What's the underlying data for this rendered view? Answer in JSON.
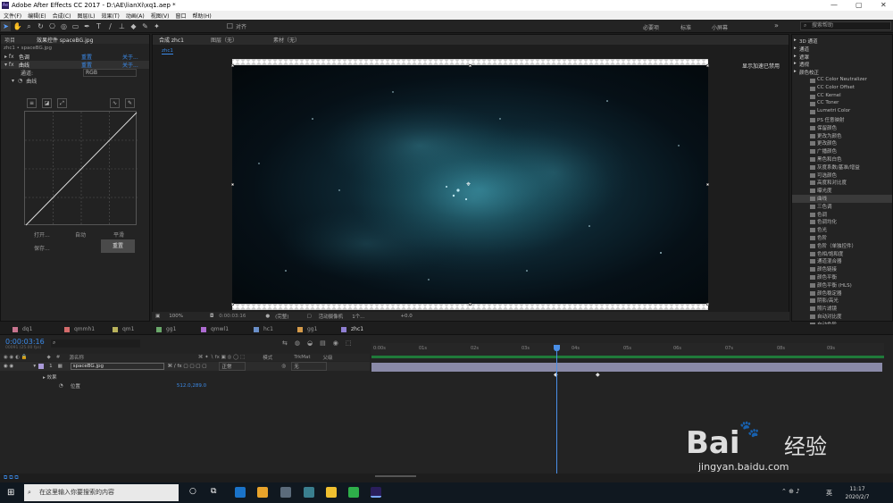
{
  "window": {
    "title": "Adobe After Effects CC 2017 - D:\\AE\\lianXi\\xq1.aep *",
    "app_icon": "Ae",
    "controls": [
      "—",
      "▢",
      "✕"
    ]
  },
  "menu": [
    "文件(F)",
    "编辑(E)",
    "合成(C)",
    "图层(L)",
    "效果(T)",
    "动画(A)",
    "视图(V)",
    "窗口",
    "帮助(H)"
  ],
  "toolbar": {
    "snap_label": "对齐",
    "workspaces": [
      "必要项",
      "标准",
      "小屏幕"
    ],
    "search_placeholder": "搜索帮助"
  },
  "left_panel": {
    "tab_project": "项目",
    "tab_effects": "效果控件 spaceBG.jpg",
    "breadcrumb": "zhc1 • spaceBG.jpg",
    "fx1": {
      "name": "色调",
      "reset": "重置",
      "about": "关于..."
    },
    "fx2": {
      "name": "曲线",
      "reset": "重置",
      "about": "关于..."
    },
    "channel_label": "通道:",
    "channel_value": "RGB",
    "curve_label": "曲线",
    "buttons": {
      "open": "打开...",
      "auto": "自动",
      "smooth": "平滑",
      "save": "保存...",
      "reset": "重置"
    }
  },
  "viewer": {
    "tab_comp": "合成 zhc1",
    "tab_layer": "图层（无）",
    "tab_footage": "素材（无）",
    "comp_chip": "zhc1",
    "gpu_label": "显示加速已禁用",
    "footer": {
      "zoom": "100%",
      "timecode": "0:00:03:16",
      "quality": "(完整)",
      "camera": "活动摄像机",
      "views": "1个...",
      "exposure": "+0.0"
    }
  },
  "effects_panel": {
    "categories": [
      "通道",
      "遮罩",
      "颜色校正"
    ],
    "extra_categories": [
      "3D 通道",
      "透视",
      "风格化"
    ],
    "items": [
      "CC Color Neutralizer",
      "CC Color Offset",
      "CC Kernel",
      "CC Toner",
      "Lumetri Color",
      "PS 任意映射",
      "保留颜色",
      "更改为颜色",
      "更改颜色",
      "广播颜色",
      "黑色和白色",
      "灰度系数/基准/增益",
      "可选颜色",
      "高度和对比度",
      "曝光度",
      "曲线",
      "三色调",
      "色调",
      "色调均化",
      "色光",
      "色阶",
      "色阶（单独控件）",
      "色相/饱和度",
      "通道混合器",
      "颜色链接",
      "颜色平衡",
      "颜色平衡 (HLS)",
      "颜色稳定器",
      "阴影/高光",
      "照片滤镜",
      "自动对比度",
      "自动色阶"
    ],
    "highlighted": "曲线"
  },
  "comp_tabs": [
    {
      "name": "dq1",
      "color": "#c8748f"
    },
    {
      "name": "qmmh1",
      "color": "#d36b6b"
    },
    {
      "name": "qm1",
      "color": "#b9b25b"
    },
    {
      "name": "gg1",
      "color": "#6aa86a"
    },
    {
      "name": "qmwl1",
      "color": "#ad6bd1"
    },
    {
      "name": "hc1",
      "color": "#6a8fc9"
    },
    {
      "name": "gg1",
      "color": "#d69b4a"
    },
    {
      "name": "zhc1",
      "color": "#8f7fd2"
    }
  ],
  "timeline": {
    "timecode": "0:00:03:16",
    "fps": "00091 (25.00 fps)",
    "headers": {
      "num": "#",
      "name": "源名称",
      "mode": "模式",
      "trkmat": "TrkMat",
      "parent": "父级"
    },
    "layer": {
      "index": "1",
      "name": "spaceBG.jpg",
      "mode": "正常",
      "parent": "无",
      "effects": "效果",
      "position_label": "位置",
      "position_value": "512.0,289.0"
    },
    "ruler": [
      "0:00s",
      "01s",
      "02s",
      "03s",
      "04s",
      "05s",
      "06s",
      "07s",
      "08s",
      "09s"
    ]
  },
  "taskbar": {
    "search_placeholder": "在这里输入你要搜索的内容",
    "ime": "英",
    "time": "11:17",
    "date": "2020/2/7"
  },
  "watermark": {
    "brand": "Bai",
    "brand2": "经验",
    "url": "jingyan.baidu.com"
  }
}
